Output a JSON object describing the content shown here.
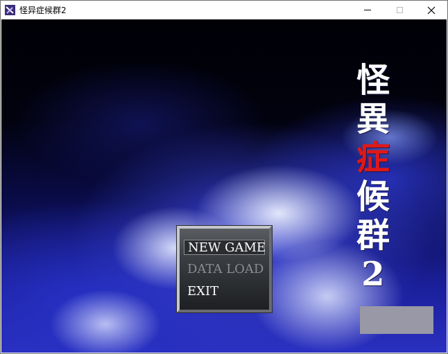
{
  "window": {
    "title": "怪异症候群2"
  },
  "game": {
    "title_chars": [
      "怪",
      "異",
      "症",
      "候",
      "群",
      "2"
    ],
    "title_highlight_color": "#e01818",
    "menu": {
      "items": [
        {
          "label": "NEW GAME",
          "state": "selected"
        },
        {
          "label": "DATA LOAD",
          "state": "disabled"
        },
        {
          "label": "EXIT",
          "state": "enabled"
        }
      ]
    }
  }
}
